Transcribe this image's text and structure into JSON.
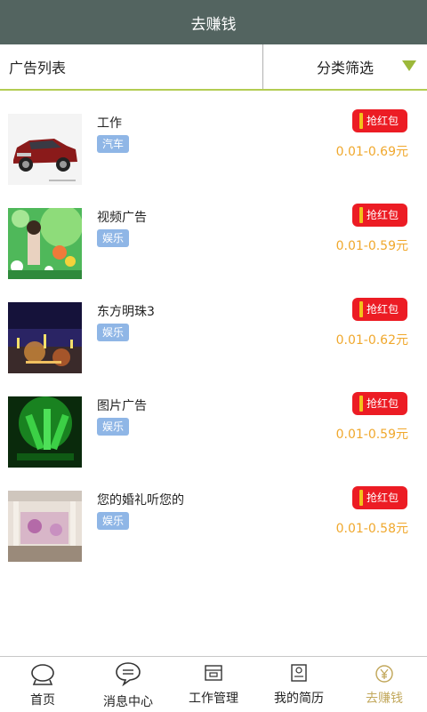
{
  "header": {
    "title": "去赚钱"
  },
  "filter": {
    "left_label": "广告列表",
    "right_label": "分类筛选"
  },
  "ads": [
    {
      "title": "工作",
      "tag": "汽车",
      "button": "抢红包",
      "price": "0.01-0.69元",
      "image": "car-photo"
    },
    {
      "title": "视频广告",
      "tag": "娱乐",
      "button": "抢红包",
      "price": "0.01-0.59元",
      "image": "woman-flowers-photo"
    },
    {
      "title": "东方明珠3",
      "tag": "娱乐",
      "button": "抢红包",
      "price": "0.01-0.62元",
      "image": "night-city-photo"
    },
    {
      "title": "图片广告",
      "tag": "娱乐",
      "button": "抢红包",
      "price": "0.01-0.59元",
      "image": "green-bottles-photo"
    },
    {
      "title": "您的婚礼听您的",
      "tag": "娱乐",
      "button": "抢红包",
      "price": "0.01-0.58元",
      "image": "wedding-hall-photo"
    }
  ],
  "tabs": [
    {
      "label": "首页",
      "icon": "home-icon"
    },
    {
      "label": "消息中心",
      "icon": "chat-icon"
    },
    {
      "label": "工作管理",
      "icon": "work-icon"
    },
    {
      "label": "我的简历",
      "icon": "resume-icon"
    },
    {
      "label": "去赚钱",
      "icon": "yen-icon",
      "active": true
    }
  ],
  "colors": {
    "header_bg": "#536460",
    "accent_green": "#b3cc52",
    "red_button": "#ec1c24",
    "price_orange": "#f0a82d",
    "tag_blue": "#8fb6e6",
    "active_tab": "#c2a85c"
  }
}
